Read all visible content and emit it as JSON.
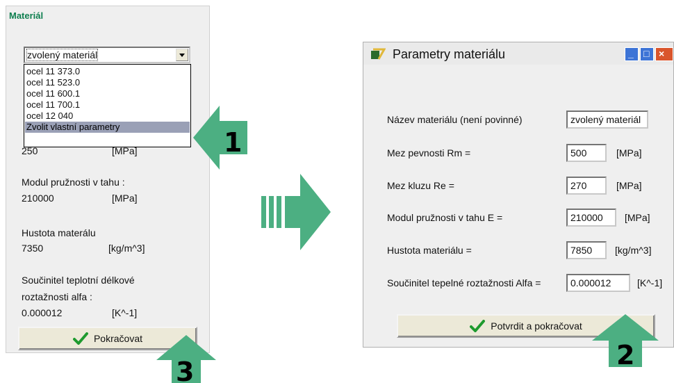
{
  "left_panel": {
    "title": "Materiál",
    "combo_value": "zvolený materiál",
    "dropdown_items": [
      "ocel 11 373.0",
      "ocel 11 523.0",
      "ocel 11 600.1",
      "ocel 11 700.1",
      "ocel 12 040",
      "Zvolit vlastní parametry"
    ],
    "partial_value": "250",
    "partial_unit": "[MPa]",
    "modulus_label": "Modul pružnosti v tahu :",
    "modulus_value": "210000",
    "modulus_unit": "[MPa]",
    "density_label": "Hustota materálu",
    "density_value": "7350",
    "density_unit": "[kg/m^3]",
    "alpha_label_1": "Součinitel teplotní délkové",
    "alpha_label_2": "roztažnosti alfa :",
    "alpha_value": "0.000012",
    "alpha_unit": "[K^-1]",
    "continue_button": "Pokračovat"
  },
  "dialog": {
    "title": "Parametry materiálu",
    "fields": [
      {
        "label": "Název materiálu (není povinné)",
        "value": "zvolený materiál",
        "unit": ""
      },
      {
        "label": "Mez pevnosti Rm =",
        "value": "500",
        "unit": "[MPa]"
      },
      {
        "label": "Mez kluzu Re =",
        "value": "270",
        "unit": "[MPa]"
      },
      {
        "label": "Modul pružnosti v tahu E =",
        "value": "210000",
        "unit": "[MPa]"
      },
      {
        "label": "Hustota materiálu =",
        "value": "7850",
        "unit": "[kg/m^3]"
      },
      {
        "label": "Součinitel tepelné roztažnosti Alfa =",
        "value": "0.000012",
        "unit": "[K^-1]"
      }
    ],
    "confirm_button": "Potvrdit a pokračovat"
  },
  "step_numbers": [
    "1",
    "2",
    "3"
  ],
  "colors": {
    "arrow_green": "#4caf82",
    "title_green": "#0e7f4f",
    "check_green": "#1e9a2e"
  },
  "icons": [
    "check-icon",
    "app-icon",
    "minimize-icon",
    "maximize-icon",
    "close-icon",
    "dropdown-arrow-icon"
  ]
}
